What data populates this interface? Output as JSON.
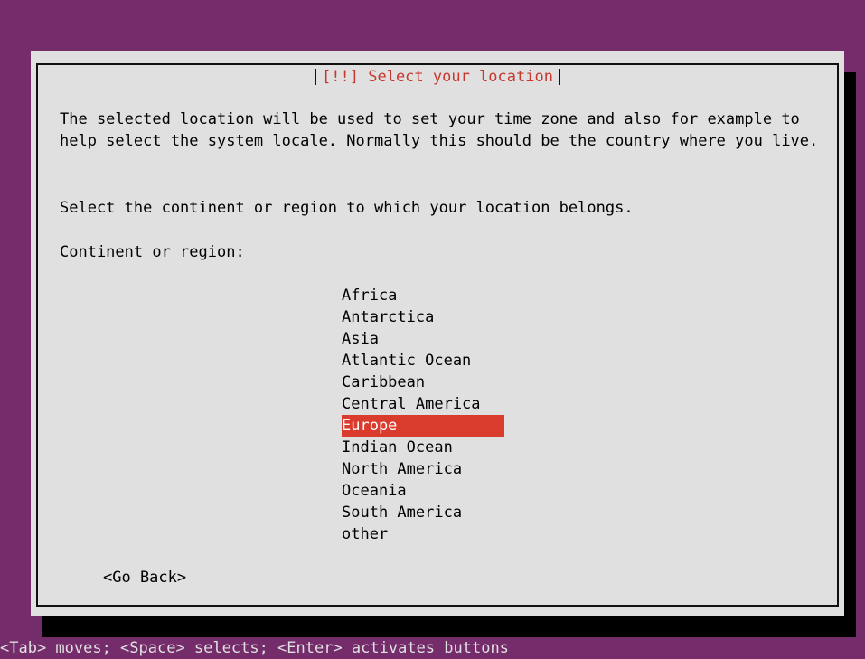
{
  "dialog": {
    "title": "[!!] Select your location",
    "description": "The selected location will be used to set your time zone and also for example to help select the system locale. Normally this should be the country where you live.",
    "instruction": "Select the continent or region to which your location belongs.",
    "list_label": "Continent or region:",
    "options": [
      "Africa",
      "Antarctica",
      "Asia",
      "Atlantic Ocean",
      "Caribbean",
      "Central America",
      "Europe",
      "Indian Ocean",
      "North America",
      "Oceania",
      "South America",
      "other"
    ],
    "selected_option": "Europe",
    "go_back_label": "<Go Back>"
  },
  "status_bar": {
    "text": "<Tab> moves; <Space> selects; <Enter> activates buttons"
  },
  "colors": {
    "background": "#742c6b",
    "dialog": "#e0e0e0",
    "selection": "#d93b2d",
    "title": "#c8372d"
  }
}
